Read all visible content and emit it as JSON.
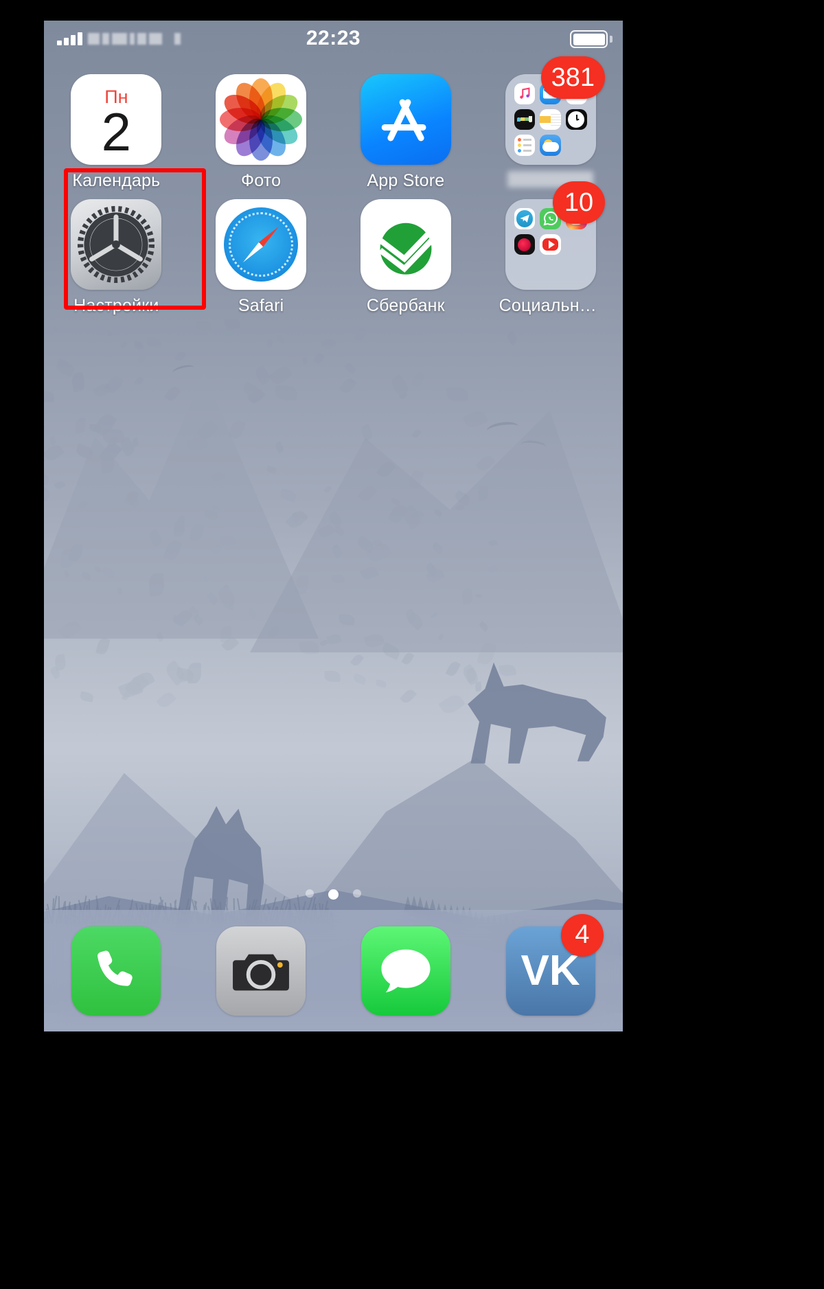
{
  "status_bar": {
    "signal_icon": "cellular-signal-icon",
    "carrier": "",
    "carrier_blurred": true,
    "time": "22:23",
    "battery_icon": "battery-full-icon"
  },
  "home_screen": {
    "rows": [
      {
        "apps": [
          {
            "name": "calendar",
            "label": "Календарь",
            "day_of_week": "Пн",
            "day_number": "2",
            "badge": ""
          },
          {
            "name": "photos",
            "label": "Фото",
            "badge": ""
          },
          {
            "name": "app-store",
            "label": "App Store",
            "badge": ""
          },
          {
            "name": "utilities-folder",
            "label": "",
            "label_blurred": true,
            "badge": "381",
            "folder_items": [
              "music-icon",
              "mail-icon",
              "app-white-icon",
              "wallet-icon",
              "notes-icon",
              "clock-icon",
              "reminders-icon",
              "weather-icon"
            ]
          }
        ]
      },
      {
        "apps": [
          {
            "name": "settings",
            "label": "Настройки",
            "badge": "",
            "highlighted": true
          },
          {
            "name": "safari",
            "label": "Safari",
            "badge": ""
          },
          {
            "name": "sberbank",
            "label": "Сбербанк",
            "badge": ""
          },
          {
            "name": "social-folder",
            "label": "Социальны...",
            "badge": "10",
            "folder_items": [
              "telegram-icon",
              "whatsapp-icon",
              "instagram-icon",
              "tiktok-icon",
              "youtube-icon"
            ]
          }
        ]
      }
    ],
    "page_dots": {
      "count": 3,
      "active_index": 1
    }
  },
  "dock": {
    "apps": [
      {
        "name": "phone",
        "label": "",
        "badge": ""
      },
      {
        "name": "camera",
        "label": "",
        "badge": ""
      },
      {
        "name": "messages",
        "label": "",
        "badge": ""
      },
      {
        "name": "vk",
        "label": "VK",
        "badge": "4"
      }
    ]
  },
  "annotation": {
    "highlight_color": "#ff0000",
    "highlight_target": "settings"
  },
  "colors": {
    "badge_red": "#f52f21",
    "calendar_red": "#f0453c",
    "accent_blue": "#0a84ff"
  }
}
